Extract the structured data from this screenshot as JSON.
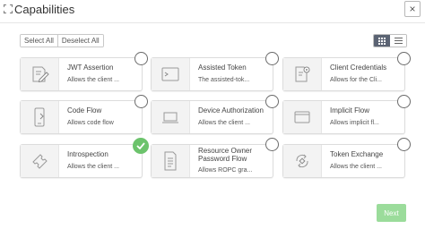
{
  "header": {
    "title": "Capabilities",
    "close_label": "×"
  },
  "selection": {
    "select_all": "Select All",
    "deselect_all": "Deselect All"
  },
  "view_toggle": {
    "active": "grid"
  },
  "cards": [
    {
      "title": "JWT Assertion",
      "desc": "Allows the client ...",
      "icon": "document-edit-icon",
      "checked": false
    },
    {
      "title": "Assisted Token",
      "desc": "The assisted-tok...",
      "icon": "terminal-window-icon",
      "checked": false
    },
    {
      "title": "Client Credentials",
      "desc": "Allows for the Cli...",
      "icon": "document-gear-icon",
      "checked": false
    },
    {
      "title": "Code Flow",
      "desc": "Allows code flow",
      "icon": "mobile-device-icon",
      "checked": false
    },
    {
      "title": "Device Authorization",
      "desc": "Allows the client ...",
      "icon": "laptop-icon",
      "checked": false
    },
    {
      "title": "Implicit Flow",
      "desc": "Allows implicit fl...",
      "icon": "browser-window-icon",
      "checked": false
    },
    {
      "title": "Introspection",
      "desc": "Allows the client ...",
      "icon": "ticket-icon",
      "checked": true
    },
    {
      "title": "Resource Owner Password Flow",
      "desc": "Allows ROPC gra...",
      "icon": "document-list-icon",
      "checked": false
    },
    {
      "title": "Token Exchange",
      "desc": "Allows the client ...",
      "icon": "exchange-icon",
      "checked": false
    }
  ],
  "footer": {
    "next_label": "Next"
  },
  "colors": {
    "check_green": "#6cc36c",
    "next_green": "#9bdc9b",
    "toggle_active": "#5b6373"
  }
}
